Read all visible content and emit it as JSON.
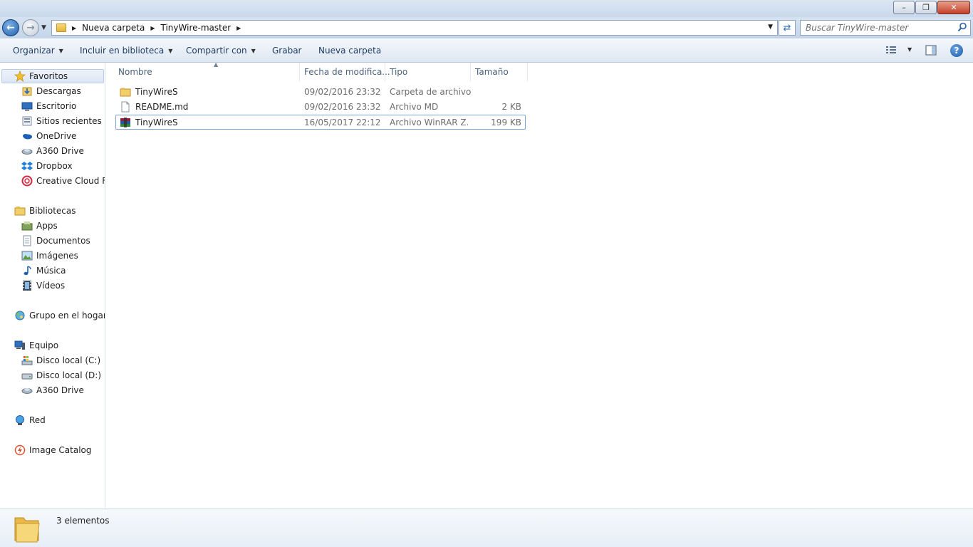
{
  "window": {
    "minimize_glyph": "–",
    "maximize_glyph": "❐",
    "close_glyph": "✕"
  },
  "address": {
    "crumbs": [
      "Nueva carpeta",
      "TinyWire-master"
    ],
    "search_placeholder": "Buscar TinyWire-master"
  },
  "toolbar": {
    "organize": "Organizar",
    "include_library": "Incluir en biblioteca",
    "share_with": "Compartir con",
    "burn": "Grabar",
    "new_folder": "Nueva carpeta",
    "help_glyph": "?"
  },
  "navpane": {
    "favorites": {
      "label": "Favoritos",
      "items": [
        "Descargas",
        "Escritorio",
        "Sitios recientes",
        "OneDrive",
        "A360 Drive",
        "Dropbox",
        "Creative Cloud Files"
      ]
    },
    "libraries": {
      "label": "Bibliotecas",
      "items": [
        "Apps",
        "Documentos",
        "Imágenes",
        "Música",
        "Vídeos"
      ]
    },
    "homegroup": "Grupo en el hogar",
    "computer": {
      "label": "Equipo",
      "items": [
        "Disco local (C:)",
        "Disco local (D:)",
        "A360 Drive"
      ]
    },
    "network": "Red",
    "image_catalog": "Image Catalog"
  },
  "filelist": {
    "columns": {
      "name": "Nombre",
      "date": "Fecha de modifica...",
      "type": "Tipo",
      "size": "Tamaño"
    },
    "rows": [
      {
        "name": "TinyWireS",
        "date": "09/02/2016 23:32",
        "type": "Carpeta de archivos",
        "size": "",
        "icon": "folder-icon"
      },
      {
        "name": "README.md",
        "date": "09/02/2016 23:32",
        "type": "Archivo MD",
        "size": "2 KB",
        "icon": "document-icon"
      },
      {
        "name": "TinyWireS",
        "date": "16/05/2017 22:12",
        "type": "Archivo WinRAR Z...",
        "size": "199 KB",
        "icon": "winrar-icon"
      }
    ]
  },
  "status": {
    "count": "3 elementos"
  }
}
